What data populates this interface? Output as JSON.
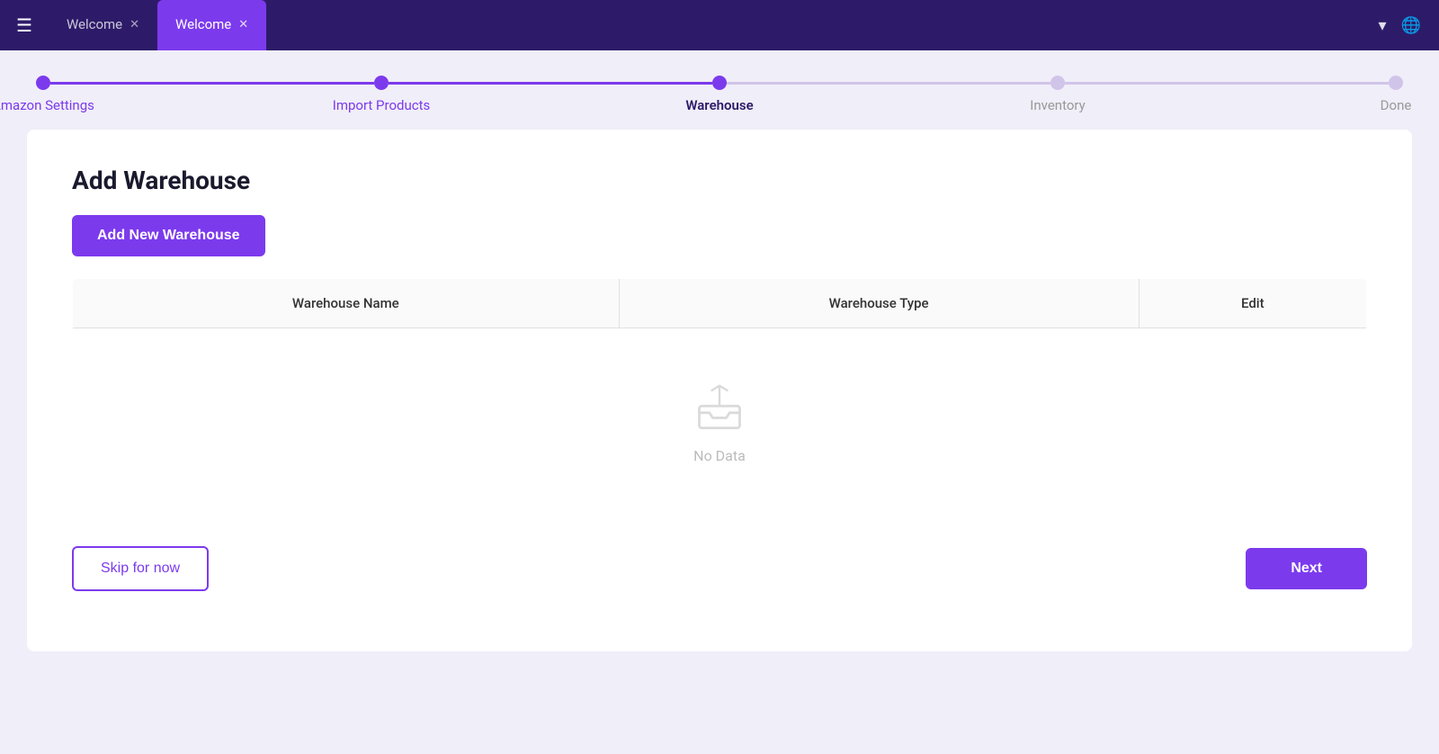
{
  "header": {
    "menu_icon": "☰",
    "tabs": [
      {
        "label": "Welcome",
        "active": false,
        "closeable": true
      },
      {
        "label": "Welcome",
        "active": true,
        "closeable": true
      }
    ],
    "chevron_icon": "▾",
    "globe_icon": "🌐"
  },
  "stepper": {
    "steps": [
      {
        "label": "Amazon Settings",
        "state": "done"
      },
      {
        "label": "Import Products",
        "state": "done"
      },
      {
        "label": "Warehouse",
        "state": "active"
      },
      {
        "label": "Inventory",
        "state": "inactive"
      },
      {
        "label": "Done",
        "state": "inactive"
      }
    ]
  },
  "main": {
    "title": "Add Warehouse",
    "add_button_label": "Add New Warehouse",
    "table": {
      "columns": [
        {
          "label": "Warehouse Name"
        },
        {
          "label": "Warehouse Type"
        },
        {
          "label": "Edit"
        }
      ],
      "empty_text": "No Data"
    },
    "skip_label": "Skip for now",
    "next_label": "Next"
  }
}
